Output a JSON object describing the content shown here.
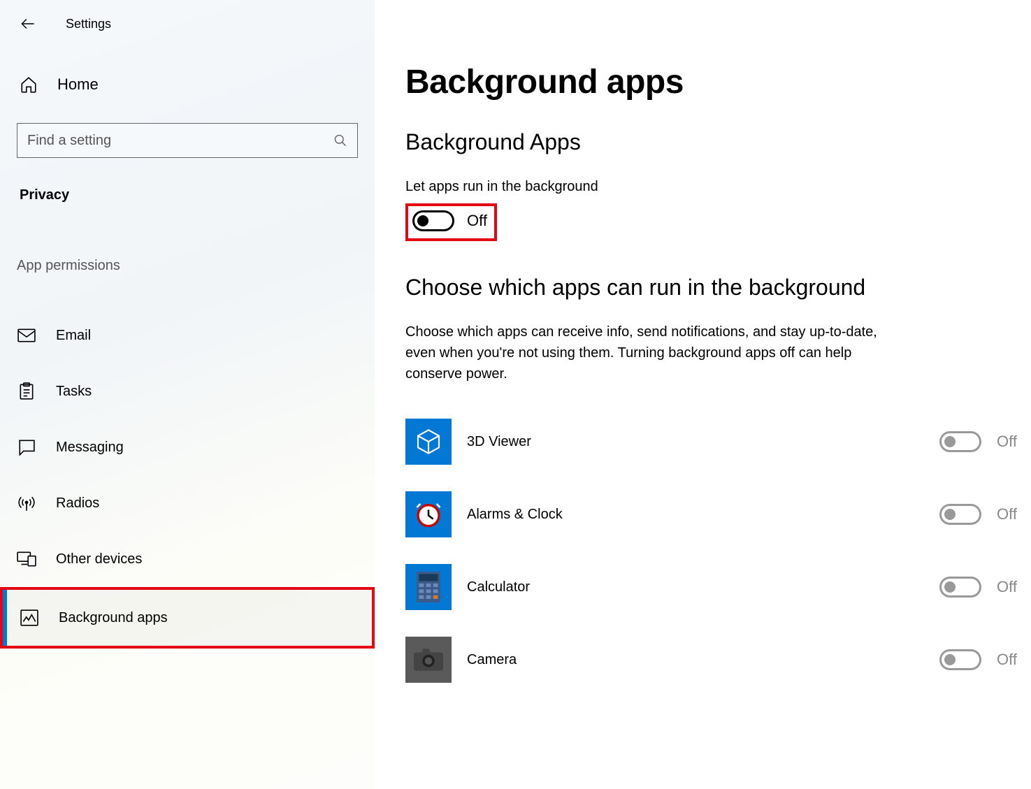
{
  "header": {
    "title": "Settings"
  },
  "sidebar": {
    "home": "Home",
    "search_placeholder": "Find a setting",
    "section": "Privacy",
    "group": "App permissions",
    "items": [
      {
        "label": "Email"
      },
      {
        "label": "Tasks"
      },
      {
        "label": "Messaging"
      },
      {
        "label": "Radios"
      },
      {
        "label": "Other devices"
      },
      {
        "label": "Background apps"
      }
    ]
  },
  "main": {
    "title": "Background apps",
    "section1": "Background Apps",
    "let_apps_label": "Let apps run in the background",
    "master_toggle_state": "Off",
    "section2": "Choose which apps can run in the background",
    "description": "Choose which apps can receive info, send notifications, and stay up-to-date, even when you're not using them. Turning background apps off can help conserve power.",
    "apps": [
      {
        "name": "3D Viewer",
        "state": "Off"
      },
      {
        "name": "Alarms & Clock",
        "state": "Off"
      },
      {
        "name": "Calculator",
        "state": "Off"
      },
      {
        "name": "Camera",
        "state": "Off"
      }
    ]
  }
}
